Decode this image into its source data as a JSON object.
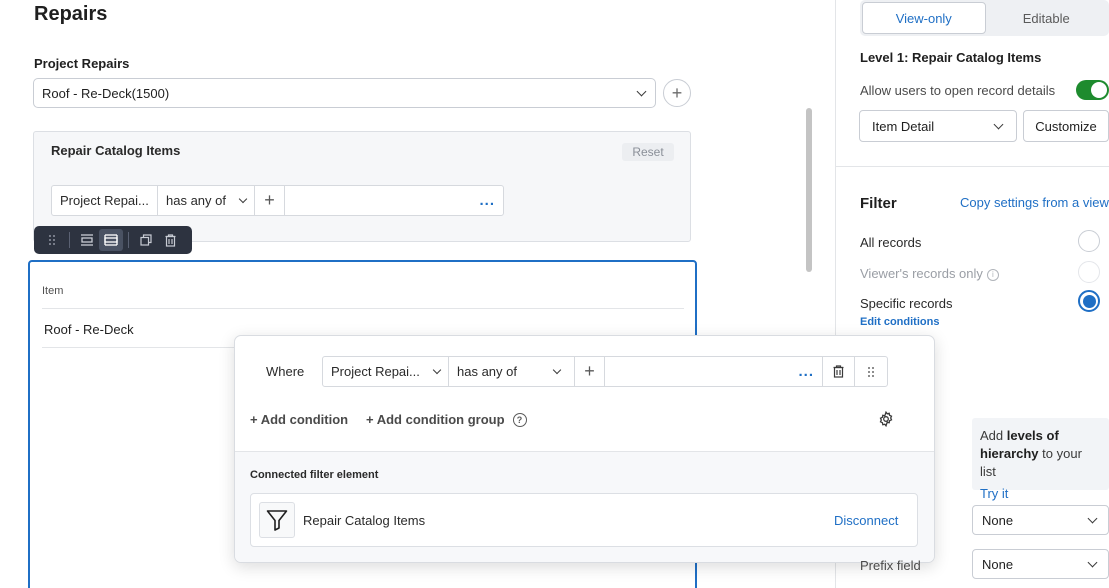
{
  "page": {
    "title": "Repairs"
  },
  "project_repairs": {
    "label": "Project Repairs",
    "selected": "Roof - Re-Deck(1500)",
    "add_symbol": "+"
  },
  "catalog_filter": {
    "title": "Repair Catalog Items",
    "reset_label": "Reset",
    "field": "Project Repai...",
    "operator": "has any of",
    "add_symbol": "+",
    "more_symbol": "..."
  },
  "item_table": {
    "header": "Item",
    "rows": [
      "Roof - Re-Deck"
    ]
  },
  "popover": {
    "where_label": "Where",
    "field": "Project Repai...",
    "operator": "has any of",
    "add_symbol": "+",
    "more_symbol": "...",
    "add_condition": "+ Add condition",
    "add_condition_group": "+ Add condition group",
    "help_symbol": "?",
    "connected_label": "Connected filter element",
    "connected_name": "Repair Catalog Items",
    "disconnect_label": "Disconnect"
  },
  "right_panel": {
    "tabs": [
      "View-only",
      "Editable"
    ],
    "active_tab": "View-only",
    "level_title": "Level 1: Repair Catalog Items",
    "allow_label": "Allow users to open record details",
    "allow_enabled": true,
    "detail_select": "Item Detail",
    "customize_label": "Customize",
    "filter_title": "Filter",
    "copy_link": "Copy settings from a view",
    "radio_options": [
      "All records",
      "Viewer's records only",
      "Specific records"
    ],
    "selected_option": "Specific records",
    "info_symbol": "i",
    "edit_conditions": "Edit conditions",
    "hint_prefix": "Add ",
    "hint_bold": "levels of hierarchy",
    "hint_suffix": " to your list",
    "try_it": "Try it",
    "select_none_1": "None",
    "select_none_2": "None",
    "prefix_field_label": "Prefix field"
  },
  "colors": {
    "accent": "#1f6fc5",
    "toggle_on": "#1e8b2e",
    "toolbar_bg": "#2d3340"
  }
}
